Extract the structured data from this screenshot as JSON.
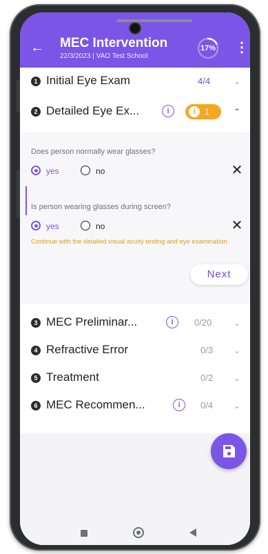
{
  "header": {
    "title": "MEC Intervention",
    "subtitle": "22/3/2023 | VAO Test School",
    "progress": "17%",
    "progress_fraction": 0.17,
    "back_icon": "arrow-left-icon",
    "menu_icon": "more-vertical-icon"
  },
  "sections": [
    {
      "num": "1",
      "title": "Initial Eye Exam",
      "count": "4/4"
    },
    {
      "num": "2",
      "title": "Detailed Eye Ex...",
      "warning_count": "1"
    },
    {
      "num": "3",
      "title": "MEC Preliminar...",
      "count": "0/20"
    },
    {
      "num": "4",
      "title": "Refractive Error",
      "count": "0/3"
    },
    {
      "num": "5",
      "title": "Treatment",
      "count": "0/2"
    },
    {
      "num": "6",
      "title": "MEC Recommen...",
      "count": "0/4"
    }
  ],
  "detailed": {
    "q1": {
      "text": "Does person normally wear glasses?",
      "yes": "yes",
      "no": "no",
      "selected": "yes"
    },
    "q2": {
      "text": "Is person wearing glasses during screen?",
      "yes": "yes",
      "no": "no",
      "selected": "yes"
    },
    "hint": "Continue with the detailed visual acuity testing and eye examination",
    "next_label": "Next"
  },
  "symbols": {
    "info": "i",
    "clear": "✕",
    "chevron_down": "⌄",
    "chevron_up": "⌃",
    "back_arrow": "←",
    "menu": "⋮"
  },
  "colors": {
    "primary": "#7b55e6",
    "warning": "#f5a623",
    "hint_text": "#e39a19"
  },
  "fab": {
    "icon": "save-icon"
  }
}
